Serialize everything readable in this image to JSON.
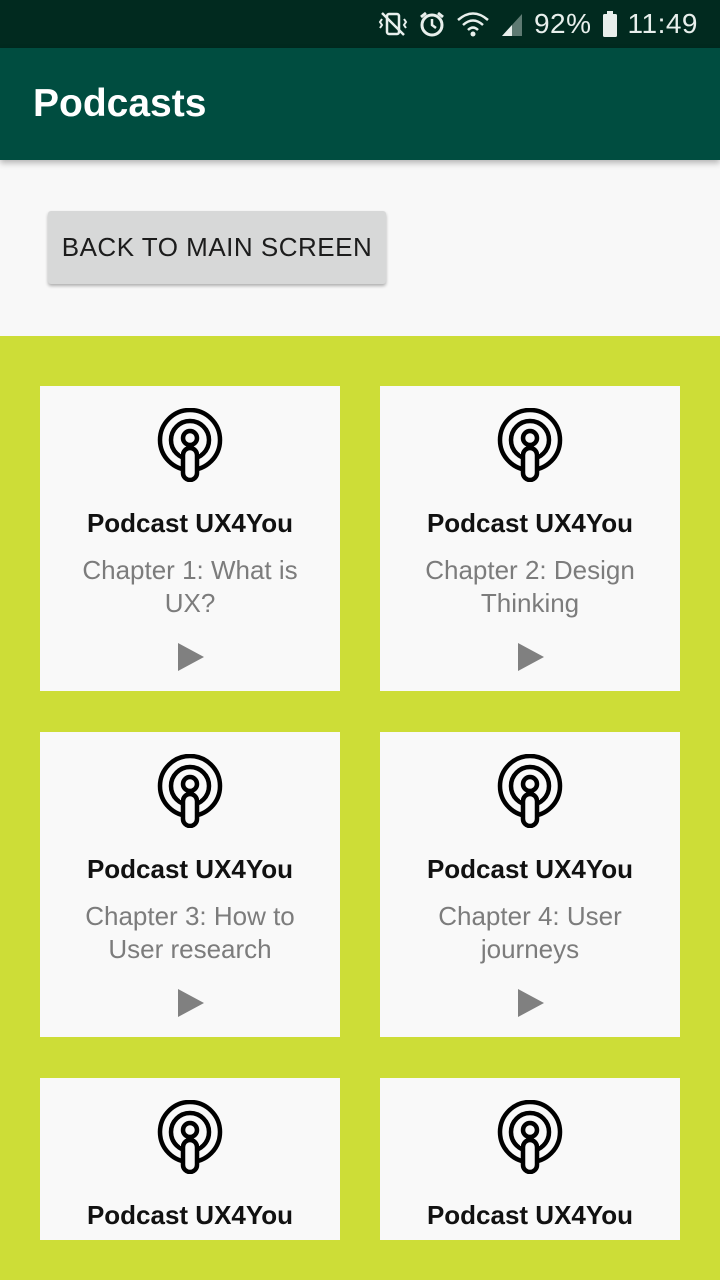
{
  "status_bar": {
    "battery": "92%",
    "time": "11:49"
  },
  "app_bar": {
    "title": "Podcasts"
  },
  "back_button": {
    "label": "BACK TO MAIN SCREEN"
  },
  "cards": [
    {
      "title": "Podcast UX4You",
      "chapter": "Chapter 1: What is UX?"
    },
    {
      "title": "Podcast UX4You",
      "chapter": "Chapter 2: Design Thinking"
    },
    {
      "title": "Podcast UX4You",
      "chapter": "Chapter 3: How to User research"
    },
    {
      "title": "Podcast UX4You",
      "chapter": "Chapter 4: User journeys"
    },
    {
      "title": "Podcast UX4You",
      "chapter": ""
    },
    {
      "title": "Podcast UX4You",
      "chapter": ""
    }
  ],
  "colors": {
    "status_bar": "#012a1f",
    "app_bar": "#004d40",
    "grid_background": "#cddd37",
    "card_background": "#f9f9f9",
    "button_background": "#d7d8d8",
    "chapter_text": "#7c7c7c"
  },
  "icons": {
    "card": "podcast-icon",
    "play": "play-icon"
  }
}
